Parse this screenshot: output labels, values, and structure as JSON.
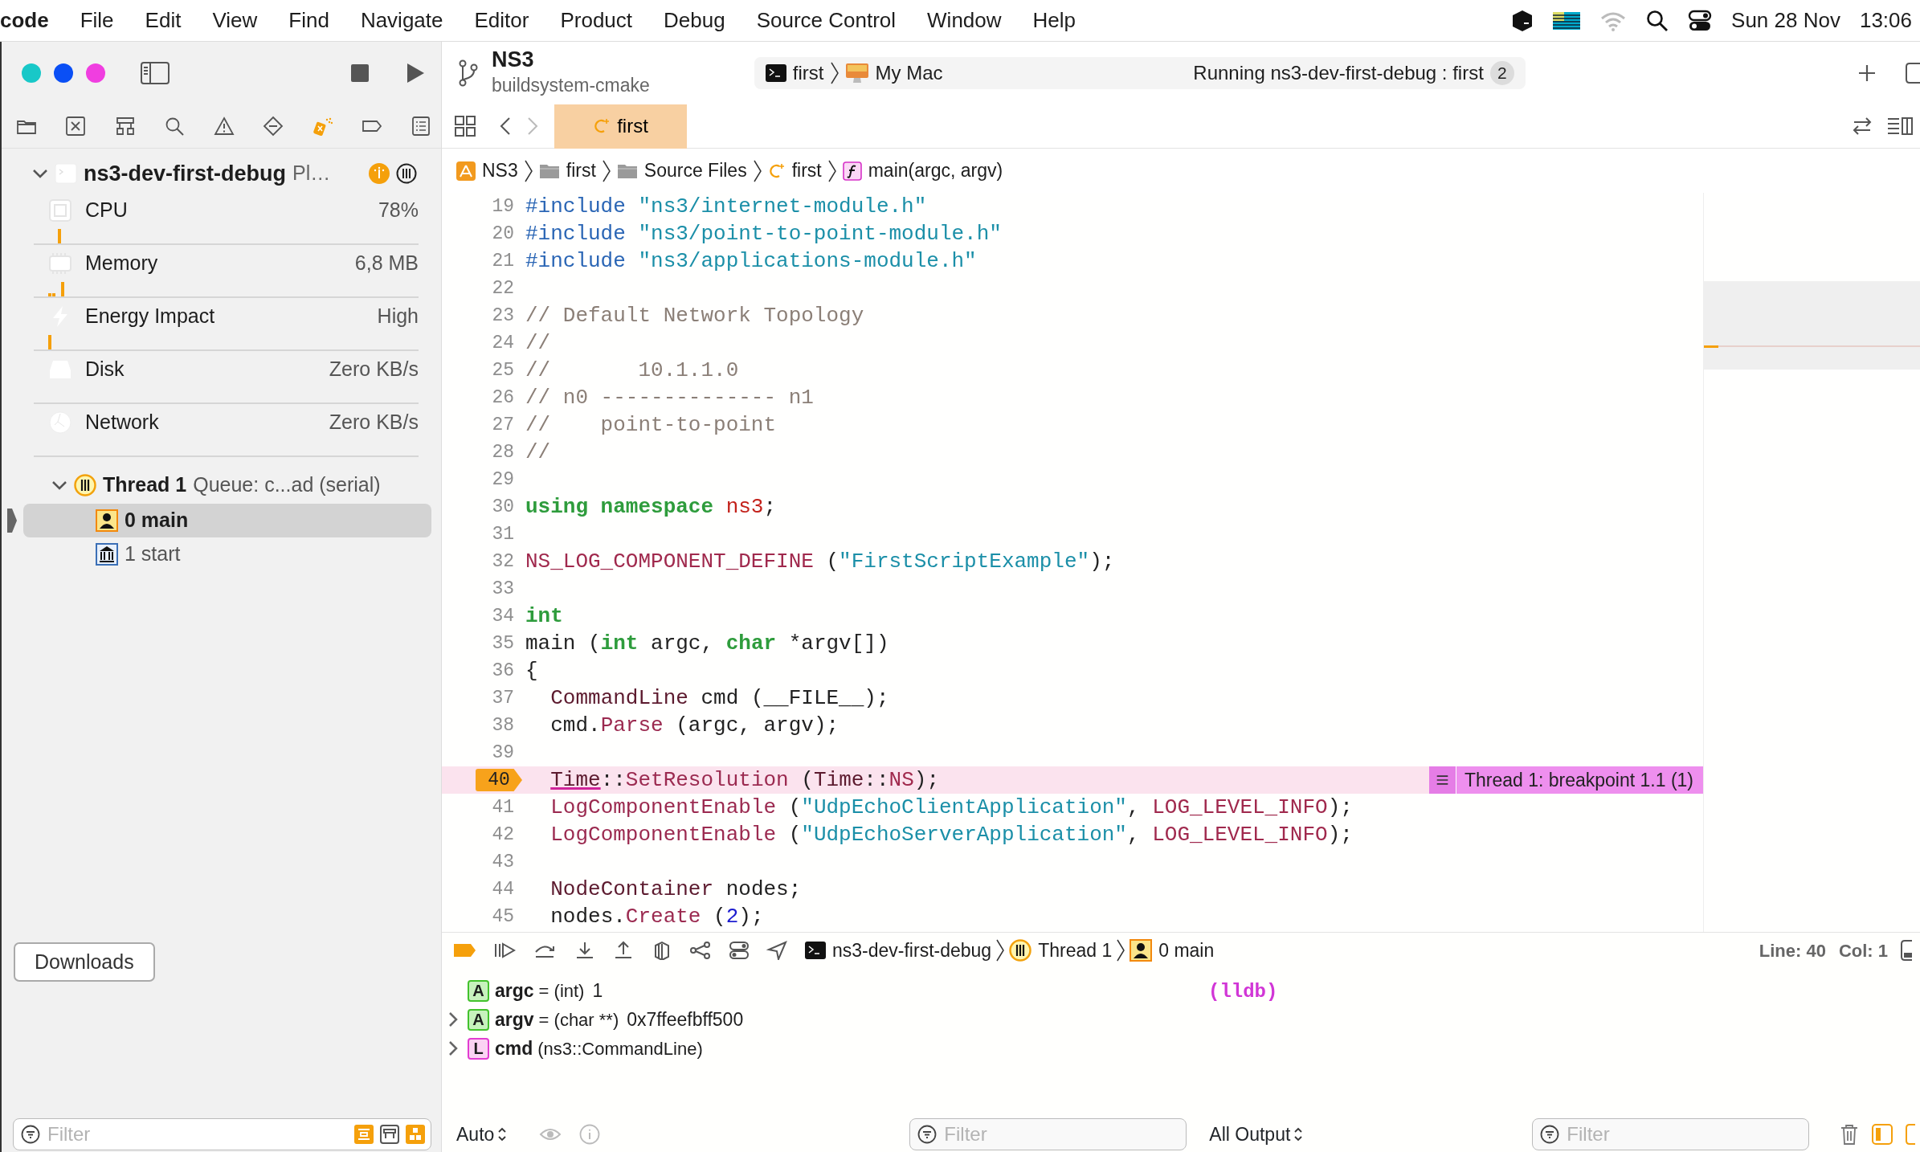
{
  "menu_bar": {
    "app": "code",
    "items": [
      "File",
      "Edit",
      "View",
      "Find",
      "Navigate",
      "Editor",
      "Product",
      "Debug",
      "Source Control",
      "Window",
      "Help"
    ],
    "date": "Sun 28 Nov",
    "time": "13:06"
  },
  "sidebar": {
    "navigator_tabs": [
      {
        "selected": false
      },
      {
        "selected": false
      },
      {
        "selected": false
      },
      {
        "selected": false
      },
      {
        "selected": false
      },
      {
        "selected": false
      },
      {
        "selected": true
      },
      {
        "selected": false
      },
      {
        "selected": false
      }
    ],
    "process": {
      "name": "ns3-dev-first-debug",
      "detail": "Pl…",
      "expanded": true
    },
    "gauges": [
      {
        "name": "CPU",
        "value": "78%"
      },
      {
        "name": "Memory",
        "value": "6,8 MB"
      },
      {
        "name": "Energy Impact",
        "value": "High"
      },
      {
        "name": "Disk",
        "value": "Zero KB/s"
      },
      {
        "name": "Network",
        "value": "Zero KB/s"
      }
    ],
    "thread": {
      "name": "Thread 1",
      "queue": "Queue: c...ad (serial)",
      "expanded": true,
      "frames": [
        {
          "label": "0 main",
          "kind": "user",
          "selected": true
        },
        {
          "label": "1 start",
          "kind": "system",
          "selected": false
        }
      ]
    },
    "downloads_button": "Downloads",
    "filter": {
      "placeholder": "Filter"
    }
  },
  "toolbar": {
    "project": "NS3",
    "branch": "buildsystem-cmake",
    "scheme": "first",
    "destination": "My Mac",
    "status": "Running ns3-dev-first-debug : first",
    "badge": "2"
  },
  "tabs": [
    {
      "label": "first",
      "selected": true
    }
  ],
  "breadcrumb": [
    {
      "label": "NS3",
      "kind": "project"
    },
    {
      "label": "first",
      "kind": "folder"
    },
    {
      "label": "Source Files",
      "kind": "folder"
    },
    {
      "label": "first",
      "kind": "file"
    },
    {
      "label": "main(argc, argv)",
      "kind": "function"
    }
  ],
  "code": {
    "lines": [
      {
        "n": "19",
        "tokens": [
          {
            "text": "#include",
            "kind": "preproc"
          },
          {
            "text": " \"ns3/internet-module.h\"",
            "kind": "string"
          }
        ]
      },
      {
        "n": "20",
        "tokens": [
          {
            "text": "#include",
            "kind": "preproc"
          },
          {
            "text": " \"ns3/point-to-point-module.h\"",
            "kind": "string"
          }
        ]
      },
      {
        "n": "21",
        "tokens": [
          {
            "text": "#include",
            "kind": "preproc"
          },
          {
            "text": " \"ns3/applications-module.h\"",
            "kind": "string"
          }
        ]
      },
      {
        "n": "22"
      },
      {
        "n": "23",
        "tokens": [
          {
            "text": "// Default Network Topology",
            "kind": "comment"
          }
        ]
      },
      {
        "n": "24",
        "tokens": [
          {
            "text": "//",
            "kind": "comment"
          }
        ]
      },
      {
        "n": "25",
        "tokens": [
          {
            "text": "//       10.1.1.0",
            "kind": "comment"
          }
        ]
      },
      {
        "n": "26",
        "tokens": [
          {
            "text": "// n0 -------------- n1",
            "kind": "comment"
          }
        ]
      },
      {
        "n": "27",
        "tokens": [
          {
            "text": "//    point-to-point",
            "kind": "comment"
          }
        ]
      },
      {
        "n": "28",
        "tokens": [
          {
            "text": "//",
            "kind": "comment"
          }
        ]
      },
      {
        "n": "29"
      },
      {
        "n": "30",
        "tokens": [
          {
            "text": "using namespace",
            "kind": "keyword"
          },
          {
            "text": " ns3",
            "kind": "namespace"
          },
          {
            "text": ";",
            "kind": "plain"
          }
        ]
      },
      {
        "n": "31"
      },
      {
        "n": "32",
        "tokens": [
          {
            "text": "NS_LOG_COMPONENT_DEFINE",
            "kind": "macro"
          },
          {
            "text": " (",
            "kind": "plain"
          },
          {
            "text": "\"FirstScriptExample\"",
            "kind": "string"
          },
          {
            "text": ");",
            "kind": "plain"
          }
        ]
      },
      {
        "n": "33"
      },
      {
        "n": "34",
        "tokens": [
          {
            "text": "int",
            "kind": "keyword"
          }
        ]
      },
      {
        "n": "35",
        "tokens": [
          {
            "text": "main (",
            "kind": "plain"
          },
          {
            "text": "int",
            "kind": "keyword"
          },
          {
            "text": " argc, ",
            "kind": "plain"
          },
          {
            "text": "char",
            "kind": "keyword"
          },
          {
            "text": " *argv[])",
            "kind": "plain"
          }
        ]
      },
      {
        "n": "36",
        "tokens": [
          {
            "text": "{",
            "kind": "plain"
          }
        ]
      },
      {
        "n": "37",
        "tokens": [
          {
            "text": "  CommandLine",
            "kind": "type"
          },
          {
            "text": " cmd (__FILE__);",
            "kind": "plain"
          }
        ]
      },
      {
        "n": "38",
        "tokens": [
          {
            "text": "  cmd.",
            "kind": "plain"
          },
          {
            "text": "Parse",
            "kind": "function"
          },
          {
            "text": " (argc, argv);",
            "kind": "plain"
          }
        ]
      },
      {
        "n": "39"
      },
      {
        "n": "40",
        "tokens": [
          {
            "text": "  Time",
            "kind": "type_marked"
          },
          {
            "text": "::",
            "kind": "plain"
          },
          {
            "text": "SetResolution",
            "kind": "function"
          },
          {
            "text": " (",
            "kind": "plain"
          },
          {
            "text": "Time",
            "kind": "type"
          },
          {
            "text": "::",
            "kind": "plain"
          },
          {
            "text": "NS",
            "kind": "macro"
          },
          {
            "text": ");",
            "kind": "plain"
          }
        ],
        "current": true,
        "annotation": "Thread 1: breakpoint 1.1 (1)"
      },
      {
        "n": "41",
        "tokens": [
          {
            "text": "  LogComponentEnable",
            "kind": "function"
          },
          {
            "text": " (",
            "kind": "plain"
          },
          {
            "text": "\"UdpEchoClientApplication\"",
            "kind": "string"
          },
          {
            "text": ", ",
            "kind": "plain"
          },
          {
            "text": "LOG_LEVEL_INFO",
            "kind": "macro"
          },
          {
            "text": ");",
            "kind": "plain"
          }
        ]
      },
      {
        "n": "42",
        "tokens": [
          {
            "text": "  LogComponentEnable",
            "kind": "function"
          },
          {
            "text": " (",
            "kind": "plain"
          },
          {
            "text": "\"UdpEchoServerApplication\"",
            "kind": "string"
          },
          {
            "text": ", ",
            "kind": "plain"
          },
          {
            "text": "LOG_LEVEL_INFO",
            "kind": "macro"
          },
          {
            "text": ");",
            "kind": "plain"
          }
        ]
      },
      {
        "n": "43"
      },
      {
        "n": "44",
        "tokens": [
          {
            "text": "  NodeContainer",
            "kind": "type"
          },
          {
            "text": " nodes;",
            "kind": "plain"
          }
        ]
      },
      {
        "n": "45",
        "tokens": [
          {
            "text": "  nodes.",
            "kind": "plain"
          },
          {
            "text": "Create",
            "kind": "function"
          },
          {
            "text": " (",
            "kind": "plain"
          },
          {
            "text": "2",
            "kind": "number"
          },
          {
            "text": ");",
            "kind": "plain"
          }
        ]
      }
    ]
  },
  "debug_bar": {
    "path": [
      {
        "label": "ns3-dev-first-debug",
        "kind": "process"
      },
      {
        "label": "Thread 1",
        "kind": "thread"
      },
      {
        "label": "0 main",
        "kind": "frame"
      }
    ],
    "line": "Line: 40",
    "col": "Col: 1"
  },
  "variables": [
    {
      "badge": "A",
      "kind": "argument",
      "name": "argc",
      "type": "= (int)",
      "value": "1",
      "expandable": false
    },
    {
      "badge": "A",
      "kind": "argument",
      "name": "argv",
      "type": "= (char **)",
      "value": "0x7ffeefbff500",
      "expandable": true
    },
    {
      "badge": "L",
      "kind": "local",
      "name": "cmd",
      "type": "(ns3::CommandLine)",
      "expandable": true
    }
  ],
  "console": {
    "prompt": "(lldb)"
  },
  "bottom_bar": {
    "variables_scope": "Auto",
    "variables_filter": {
      "placeholder": "Filter"
    },
    "output_mode": "All Output",
    "console_filter": {
      "placeholder": "Filter"
    }
  }
}
